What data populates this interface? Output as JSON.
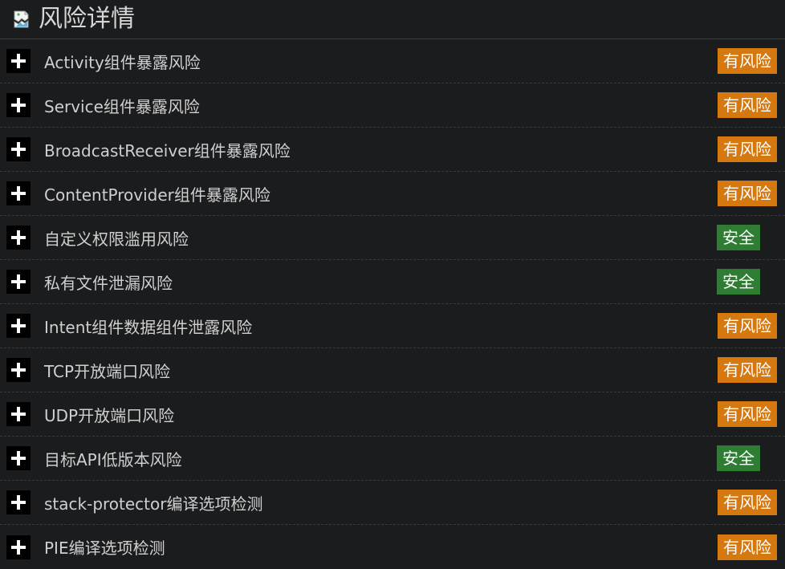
{
  "header": {
    "title": "风险详情",
    "icon": "broken-image-icon"
  },
  "colors": {
    "risk": "#d4780f",
    "safe": "#2e7d32"
  },
  "items": [
    {
      "label": "Activity组件暴露风险",
      "status": "有风险",
      "type": "risk"
    },
    {
      "label": "Service组件暴露风险",
      "status": "有风险",
      "type": "risk"
    },
    {
      "label": "BroadcastReceiver组件暴露风险",
      "status": "有风险",
      "type": "risk"
    },
    {
      "label": "ContentProvider组件暴露风险",
      "status": "有风险",
      "type": "risk"
    },
    {
      "label": "自定义权限滥用风险",
      "status": "安全",
      "type": "safe"
    },
    {
      "label": "私有文件泄漏风险",
      "status": "安全",
      "type": "safe"
    },
    {
      "label": "Intent组件数据组件泄露风险",
      "status": "有风险",
      "type": "risk"
    },
    {
      "label": "TCP开放端口风险",
      "status": "有风险",
      "type": "risk"
    },
    {
      "label": "UDP开放端口风险",
      "status": "有风险",
      "type": "risk"
    },
    {
      "label": "目标API低版本风险",
      "status": "安全",
      "type": "safe"
    },
    {
      "label": "stack-protector编译选项检测",
      "status": "有风险",
      "type": "risk"
    },
    {
      "label": "PIE编译选项检测",
      "status": "有风险",
      "type": "risk"
    }
  ]
}
